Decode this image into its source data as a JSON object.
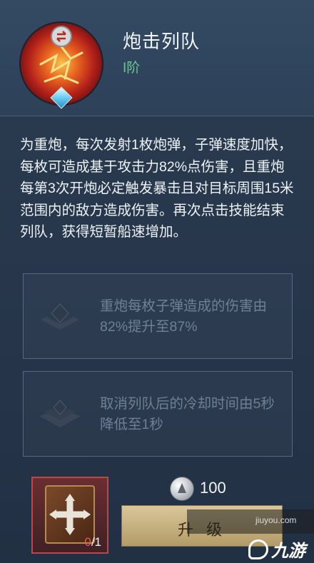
{
  "skill": {
    "name": "炮击列队",
    "rank": "I阶",
    "icon": "cannon-fire-swap-icon",
    "description": "为重炮，每次发射1枚炮弹，子弹速度加快，每枚可造成基于攻击力82%点伤害，且重炮每第3次开炮必定触发暴击且对目标周围15米范围内的敌方造成伤害。再次点击技能结束列队，获得短暂船速增加。"
  },
  "upgrades": [
    {
      "text": "重炮每枚子弹造成的伤害由82%提升至87%",
      "icon": "rank-badge-chevron-icon"
    },
    {
      "text": "取消列队后的冷却时间由5秒降低至1秒",
      "icon": "rank-badge-wings-icon"
    }
  ],
  "material": {
    "icon": "skill-book-icon",
    "have": "0",
    "need": "/1"
  },
  "cost": {
    "icon": "silver-coin-icon",
    "amount": "100"
  },
  "action_button": {
    "label": "升 级"
  },
  "watermark": {
    "url": "jiuyou.com",
    "logo": "九游"
  },
  "colors": {
    "rank": "#69c98b",
    "insufficient": "#e45757",
    "upgrade_locked_text": "#6f8094",
    "button": "#c9b47f"
  }
}
